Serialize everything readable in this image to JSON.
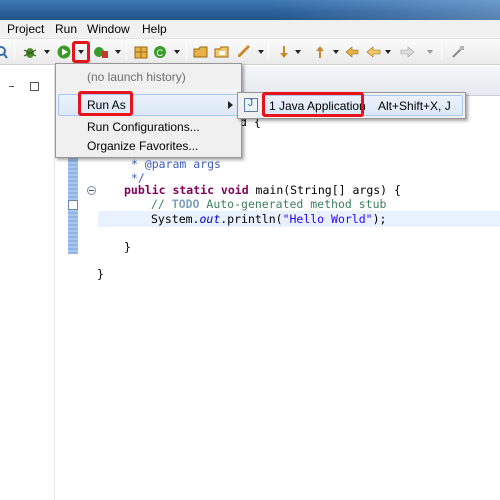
{
  "menubar": {
    "items": [
      "Project",
      "Run",
      "Window",
      "Help"
    ]
  },
  "run_dropdown": {
    "no_history": "(no launch history)",
    "run_as": "Run As",
    "run_configurations": "Run Configurations...",
    "organize_favorites": "Organize Favorites..."
  },
  "run_as_submenu": {
    "item_label": "1 Java Application",
    "shortcut": "Alt+Shift+X, J"
  },
  "code": {
    "line_class_fragment": "d {",
    "line_param": " * @param args",
    "line_comment_end": " */",
    "line_main_kw": "public static void",
    "line_main_rest": " main(String[] args) {",
    "line_todo_prefix": "// ",
    "line_todo_kw": "TODO",
    "line_todo_rest": " Auto-generated method stub",
    "line_print_a": "System.",
    "line_print_out": "out",
    "line_print_b": ".println(",
    "line_print_str": "\"Hello World\"",
    "line_print_c": ");",
    "line_close1": "}",
    "line_close2": "}"
  },
  "colors": {
    "highlight": "#e8121b",
    "keyword": "#7f0055",
    "javadoc": "#3f5fbf",
    "comment": "#3f7f5f",
    "string": "#2a00ff"
  }
}
